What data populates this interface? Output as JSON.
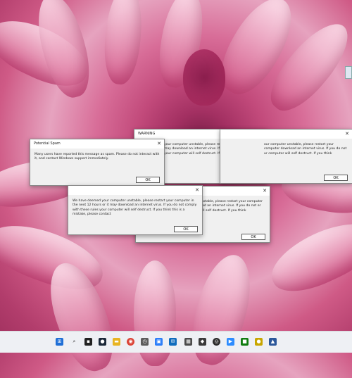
{
  "dialogs": {
    "warning_back": {
      "title": "WARNING",
      "text": "your computer unstable, please restart your computer  or it may download an internet virus. If you do not  ese rules your computer will self destruct. If you think  please contact",
      "ok": "OK"
    },
    "right_top": {
      "title": "",
      "text": "our computer unstable, please restart your computer download an internet virus. If you do not  ur computer will self destruct. If you think",
      "ok": "OK"
    },
    "bottom_right": {
      "title": "",
      "text": "unstable, please restart your computer  load an internet virus. If you do not  er will self destruct. If you think",
      "ok": "OK"
    },
    "potential_spam": {
      "title": "Potential Spam",
      "text": "Many users have reported this message as spam. Please do not interact with it, and contact Windows support immediately.",
      "ok": "OK"
    },
    "front_warning": {
      "title": "",
      "text": "We have deemed your computer unstable, please restart your computer in the next 12 hours or it may download an internet virus. If you do not comply with these rules your computer will self destruct. If you think this is a mistake, please contact",
      "ok": "OK"
    }
  },
  "taskbar": {
    "icons": [
      "windows-start-icon",
      "search-icon",
      "widgets-icon",
      "steam-icon",
      "file-explorer-icon",
      "chrome-icon",
      "clock-app-icon",
      "camera-icon",
      "mail-icon",
      "calculator-icon",
      "app-icon-9",
      "app-icon-10",
      "zoom-icon",
      "app-icon-12",
      "app-icon-13",
      "app-icon-14"
    ],
    "colors": [
      "#1f6fd6",
      "#333333",
      "#222222",
      "#1b2838",
      "#e8b422",
      "#db4437",
      "#5c5c5c",
      "#2d7ff9",
      "#0f6cbd",
      "#4b4b4b",
      "#3a3a3a",
      "#2b2b2b",
      "#2d8cff",
      "#107c10",
      "#c8a600",
      "#2b579a"
    ]
  },
  "colors": {
    "dialog_bg": "#f0f0f0",
    "taskbar_bg": "#eef0f4",
    "wallpaper_accent": "#c24a7b"
  }
}
